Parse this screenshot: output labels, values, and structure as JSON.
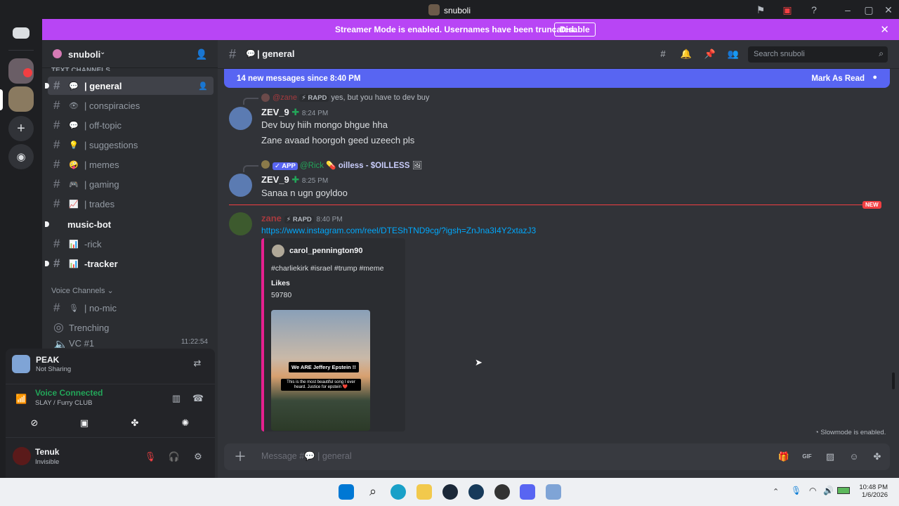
{
  "window": {
    "title": "snuboli"
  },
  "banner": {
    "text": "Streamer Mode is enabled. Usernames have been truncated.",
    "disable_label": "Disable"
  },
  "guild": {
    "name": "snuboli",
    "section_text": "Text Channels",
    "section_voice": "Voice Channels"
  },
  "channels": [
    {
      "name": "general",
      "emoji": "💬",
      "active": true
    },
    {
      "name": "conspiracies",
      "emoji": "👁"
    },
    {
      "name": "off-topic",
      "emoji": "💬"
    },
    {
      "name": "suggestions",
      "emoji": "💡"
    },
    {
      "name": "memes",
      "emoji": "🤪"
    },
    {
      "name": "gaming",
      "emoji": "🎮"
    },
    {
      "name": "trades",
      "emoji": "📈"
    },
    {
      "name": "music-bot",
      "bold": true
    },
    {
      "name": "-rick",
      "emoji": "📊"
    },
    {
      "name": "-tracker",
      "emoji": "📊",
      "bold": true
    }
  ],
  "voice_channels": [
    {
      "name": "no-mic",
      "emoji": "🎙"
    },
    {
      "name": "Trenching"
    },
    {
      "name": "VC #1",
      "timer": "11:22:54"
    }
  ],
  "activity": {
    "name": "PEAK",
    "status": "Not Sharing"
  },
  "voice": {
    "status": "Voice Connected",
    "location": "SLAY / Furry CLUB"
  },
  "user": {
    "name": "Tenuk",
    "status": "Invisible"
  },
  "header": {
    "channel": "general",
    "search_placeholder": "Search snuboli"
  },
  "new_messages": {
    "text": "14 new messages since 8:40 PM",
    "mark_read": "Mark As Read"
  },
  "messages": [
    {
      "reply_name": "@zane",
      "reply_tag": "RAPD",
      "reply_text": "yes, but you have to dev buy",
      "author": "ZEV_9",
      "time": "8:24 PM",
      "lines": [
        "Dev buy hiih mongo bhgue hha",
        "Zane avaad hoorgoh geed uzeech pls"
      ]
    },
    {
      "reply_tag": "APP",
      "reply_name": "@Rick",
      "reply_text": "oilless - $OILLESS",
      "author": "ZEV_9",
      "time": "8:25 PM",
      "lines": [
        "Sanaa n ugn goyldoo"
      ]
    },
    {
      "author": "zane",
      "tag": "RAPD",
      "time": "8:40 PM",
      "link": "https://www.instagram.com/reel/DTEShTND9cg/?igsh=ZnJna3I4Y2xtazJ3"
    }
  ],
  "new_label": "NEW",
  "embed": {
    "author": "carol_pennington90",
    "desc": "#charliekirk #israel #trump #meme",
    "field_name": "Likes",
    "field_value": "59780",
    "img_title": "We ARE Jeffery Epstein !!",
    "img_caption": "This is the most beautiful song I ever heard. Justice for epstein ❤️"
  },
  "slowmode": "Slowmode is enabled.",
  "composer": {
    "placeholder": "Message #💬 | general"
  },
  "clock": {
    "time": "10:48 PM",
    "date": "1/6/2026"
  }
}
